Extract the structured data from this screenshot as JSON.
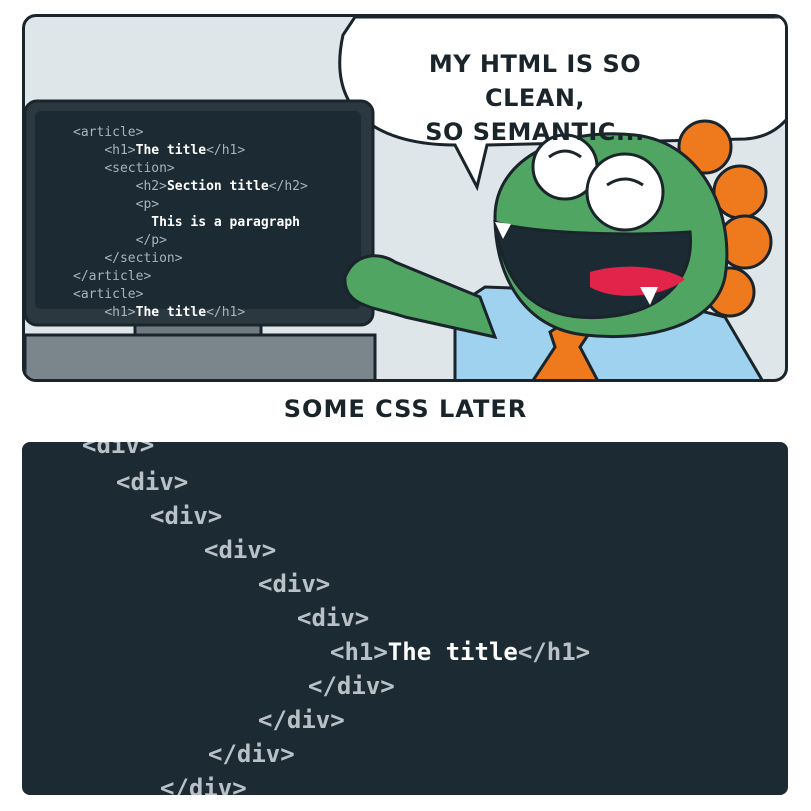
{
  "speech_bubble": {
    "line1": "MY HTML IS SO CLEAN,",
    "line2": "SO SEMANTIC..."
  },
  "monitor_code": [
    {
      "indent": "",
      "tag": "<article>",
      "text": ""
    },
    {
      "indent": "    ",
      "tag": "<h1>",
      "text": "The title",
      "close": "</h1>"
    },
    {
      "indent": "    ",
      "tag": "<section>",
      "text": ""
    },
    {
      "indent": "        ",
      "tag": "<h2>",
      "text": "Section title",
      "close": "</h2>"
    },
    {
      "indent": "        ",
      "tag": "<p>",
      "text": ""
    },
    {
      "indent": "          ",
      "tag": "",
      "text": "This is a paragraph"
    },
    {
      "indent": "        ",
      "tag": "</p>",
      "text": ""
    },
    {
      "indent": "    ",
      "tag": "</section>",
      "text": ""
    },
    {
      "indent": "",
      "tag": "</article>",
      "text": ""
    },
    {
      "indent": "",
      "tag": "<article>",
      "text": ""
    },
    {
      "indent": "    ",
      "tag": "<h1>",
      "text": "The title",
      "close": "</h1>"
    }
  ],
  "caption": "SOME CSS LATER",
  "div_code": {
    "lines": [
      "<div>",
      "<div>",
      "<div>",
      "<div>",
      "<div>",
      "<div>",
      "</div>",
      "</div>",
      "</div>",
      "</div>"
    ],
    "h1_open": "<h1>",
    "h1_text": "The title",
    "h1_close": "</h1>"
  },
  "colors": {
    "panel_bg": "#dfe6ea",
    "code_bg": "#1b2a33",
    "monster_green": "#4fa561",
    "spikes_orange": "#ef7a1e",
    "shirt_blue": "#9fd2ee",
    "tie_orange": "#ef7a1e"
  }
}
